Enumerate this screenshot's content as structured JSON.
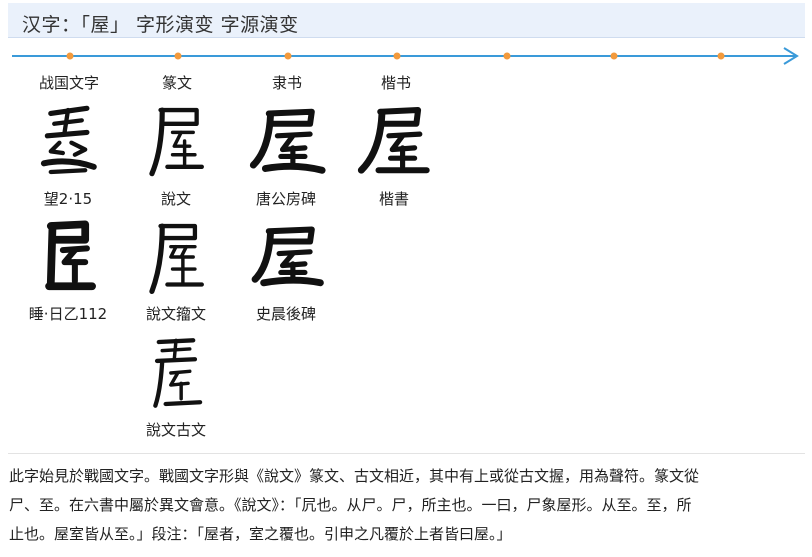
{
  "header": {
    "title": "汉字：「屋」 字形演变 字源演变"
  },
  "timeline": {
    "line_color": "#3a9ad9",
    "dot_color": "#f39a3c"
  },
  "stages": [
    {
      "label": "战国文字"
    },
    {
      "label": "篆文"
    },
    {
      "label": "隶书"
    },
    {
      "label": "楷书"
    }
  ],
  "glyphs": {
    "row1": [
      {
        "caption": "望2·15",
        "icon": "warring-states-wu-glyph-icon"
      },
      {
        "caption": "說文",
        "icon": "seal-wu-glyph-icon"
      },
      {
        "caption": "唐公房碑",
        "icon": "clerical-wu-glyph-icon"
      },
      {
        "caption": "楷書",
        "icon": "regular-wu-glyph-icon"
      }
    ],
    "row2": [
      {
        "caption": "睡·日乙112",
        "icon": "qin-bamboo-wu-glyph-icon"
      },
      {
        "caption": "說文籀文",
        "icon": "zhouwen-wu-glyph-icon"
      },
      {
        "caption": "史晨後碑",
        "icon": "clerical-stele-wu-glyph-icon"
      }
    ],
    "row3": [
      {
        "caption": "說文古文",
        "icon": "guwen-wu-glyph-icon"
      }
    ]
  },
  "description": {
    "line1": "此字始見於戰國文字。戰國文字形與《說文》篆文、古文相近，其中有上或從古文握，用為聲符。篆文從",
    "line2": "尸、至。在六書中屬於異文會意。《說文》：「凥也。从尸。尸，所主也。一曰，尸象屋形。从至。至，所",
    "line3": "止也。屋室皆从至。」段注：「屋者，室之覆也。引申之凡覆於上者皆曰屋。」"
  }
}
